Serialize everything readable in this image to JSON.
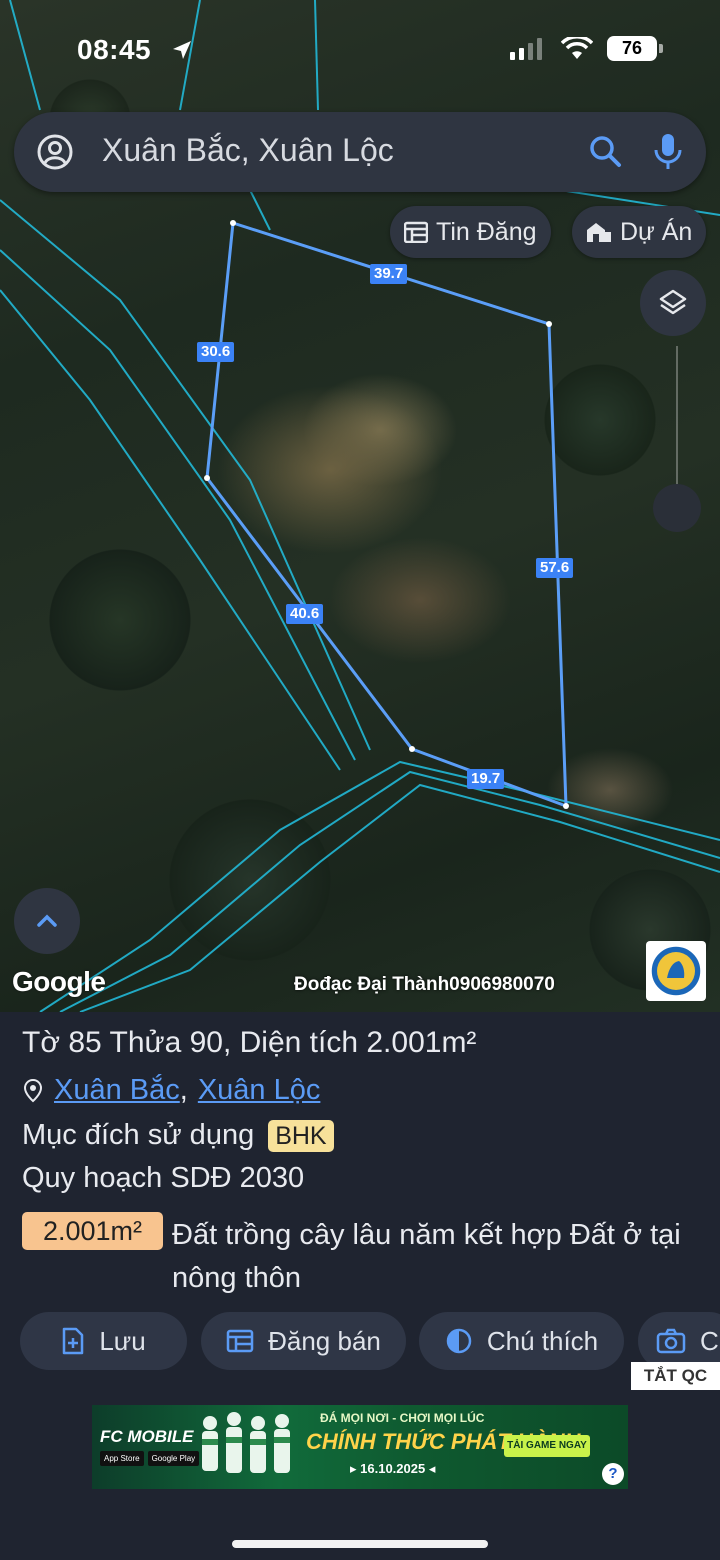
{
  "status_bar": {
    "time": "08:45",
    "battery": "76"
  },
  "search": {
    "text": "Xuân Bắc, Xuân Lộc"
  },
  "chips": {
    "listings": "Tin Đăng",
    "projects": "Dự Án"
  },
  "map": {
    "edge_lengths": [
      "39.7",
      "30.6",
      "57.6",
      "40.6",
      "19.7"
    ],
    "boundary_color": "#3b82f6",
    "road_color": "#22b8d6"
  },
  "attribution": {
    "google": "Google",
    "watermark": "Đođạc Đại Thành0906980070"
  },
  "parcel": {
    "title": "Tờ 85 Thửa 90, Diện tích 2.001m²",
    "commune": "Xuân Bắc",
    "district": "Xuân Lộc",
    "comma": ",",
    "purpose_label": "Mục đích sử dụng",
    "purpose_code": "BHK",
    "plan_label": "Quy hoạch SDĐ 2030",
    "area_badge": "2.001m²",
    "land_use": "Đất trồng cây lâu năm kết hợp Đất ở tại nông thôn"
  },
  "actions": {
    "save": "Lưu",
    "post_sale": "Đăng bán",
    "legend": "Chú thích",
    "capture": "C"
  },
  "ad": {
    "close_label": "TẮT QC",
    "game": "FC MOBILE",
    "tagline": "ĐÁ MỌI NƠI - CHƠI MỌI LÚC",
    "headline": "CHÍNH THỨC PHÁT HÀNH",
    "date": "▸ 16.10.2025 ◂",
    "cta": "TẢI GAME NGAY",
    "app_store": "App Store",
    "google_play": "Google Play",
    "help": "?"
  }
}
